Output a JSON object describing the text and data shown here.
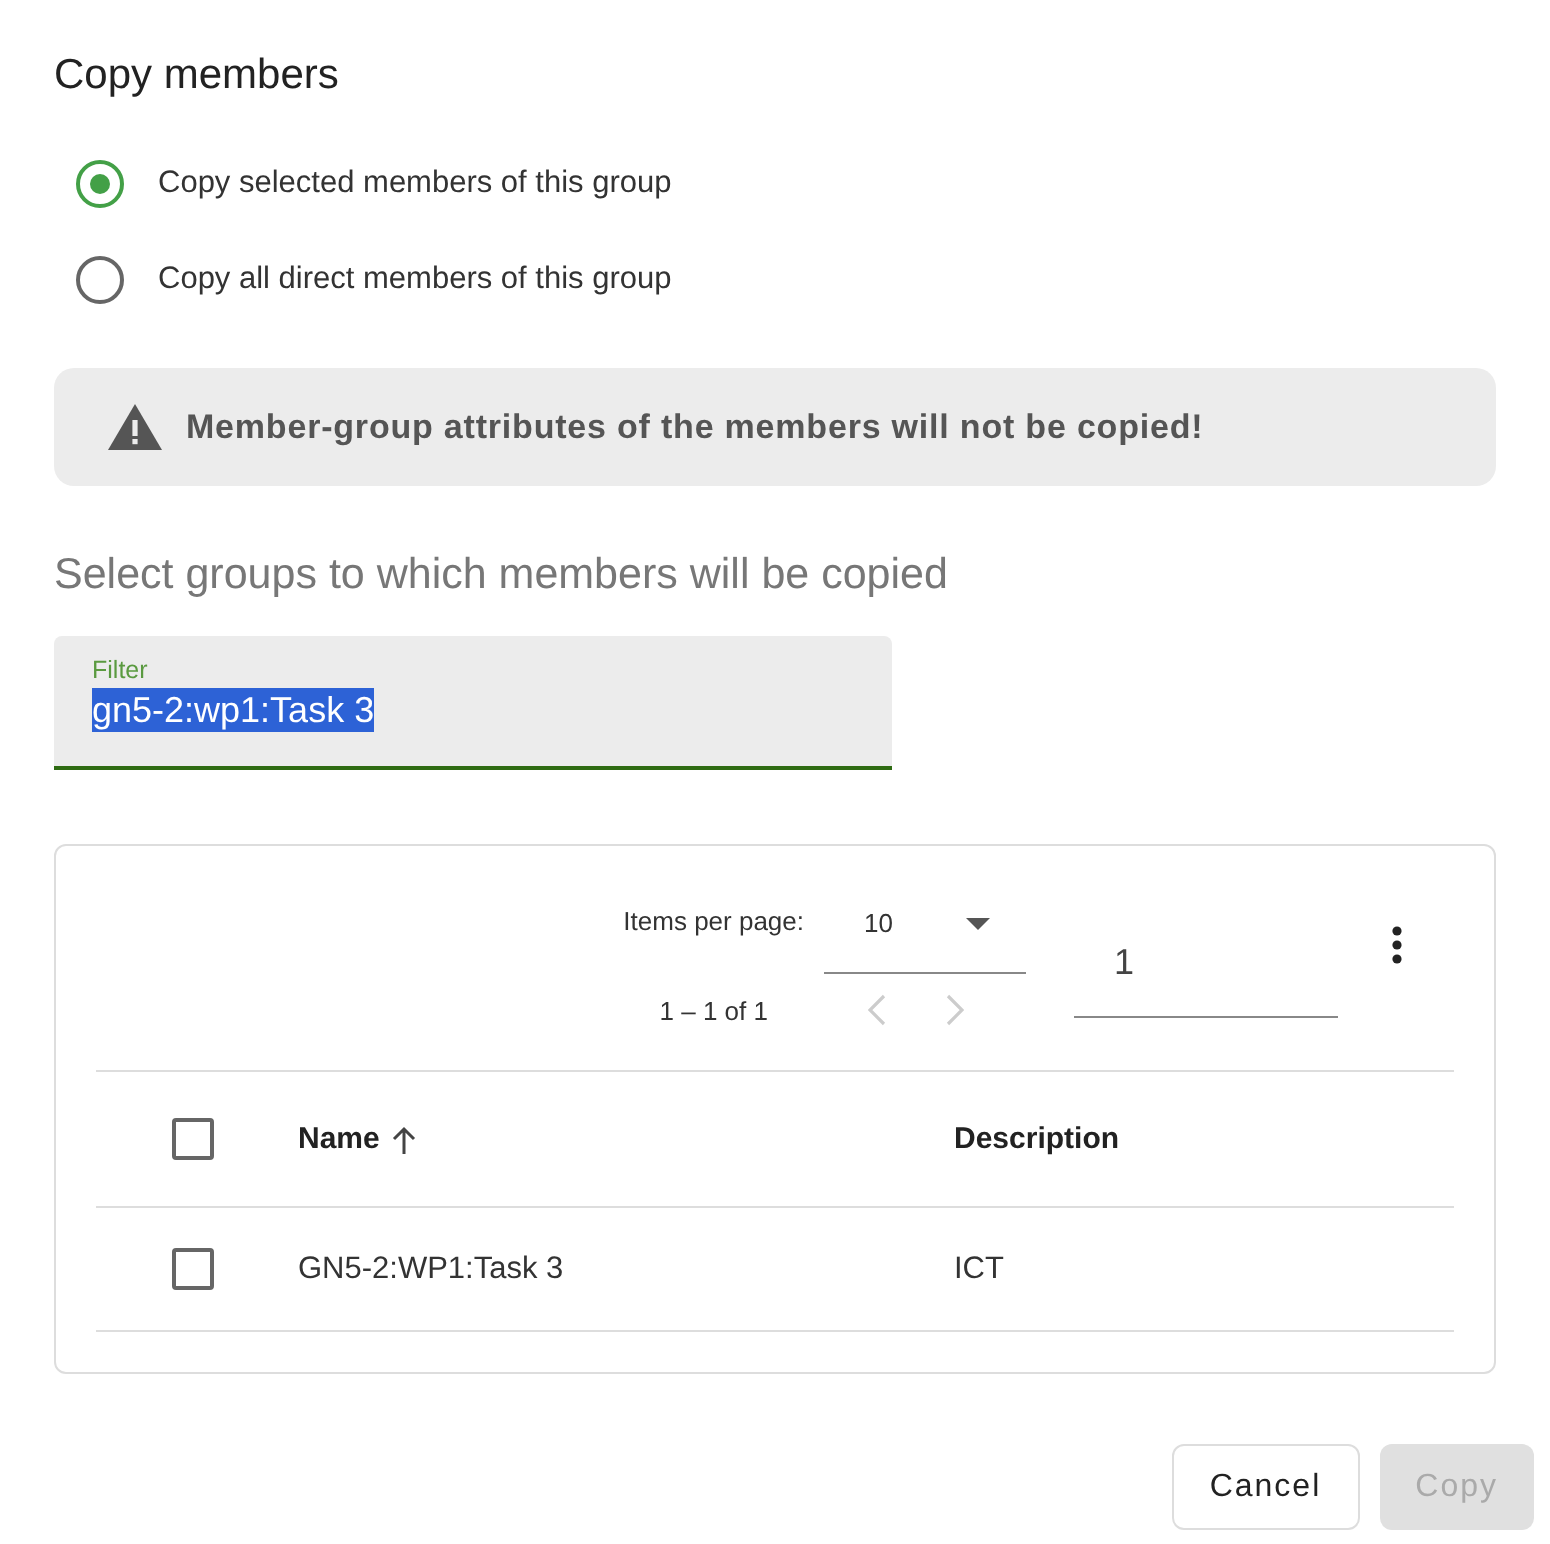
{
  "title": "Copy members",
  "options": [
    {
      "label": "Copy selected members of this group",
      "selected": true
    },
    {
      "label": "Copy all direct members of this group",
      "selected": false
    }
  ],
  "warning": "Member-group attributes of the members will not be copied!",
  "subtitle": "Select groups to which members will be copied",
  "filter": {
    "label": "Filter",
    "value": "gn5-2:wp1:Task 3",
    "text_selected": true
  },
  "paginator": {
    "items_per_page_label": "Items per page:",
    "page_size": "10",
    "range": "1 – 1 of 1",
    "page": "1",
    "prev_disabled": true,
    "next_disabled": true
  },
  "table": {
    "select_all_checked": false,
    "columns": [
      {
        "label": "Name",
        "sorted": true
      },
      {
        "label": "Description",
        "sorted": false
      }
    ],
    "rows": [
      {
        "checked": false,
        "cells": [
          "GN5-2:WP1:Task 3",
          "ICT"
        ]
      }
    ]
  },
  "buttons": [
    {
      "label": "Cancel",
      "disabled": false
    },
    {
      "label": "Copy",
      "disabled": true
    }
  ]
}
